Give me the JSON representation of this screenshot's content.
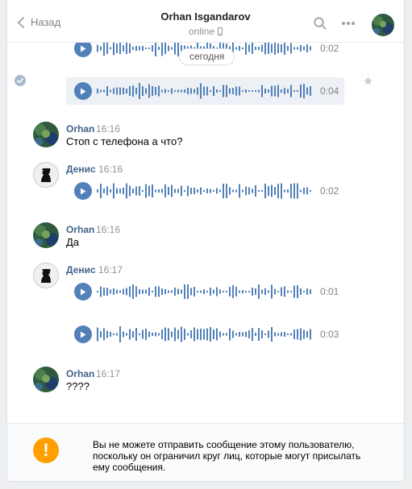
{
  "header": {
    "back_label": "Назад",
    "title": "Orhan Isgandarov",
    "status": "online"
  },
  "date_divider": "сегодня",
  "messages": [
    {
      "sender": "Orhan",
      "time": "16:16",
      "text": "Стоп с телефона а что?"
    },
    {
      "sender": "Денис",
      "time": "16:16",
      "voice_duration": "0:02"
    },
    {
      "sender": "Orhan",
      "time": "16:16",
      "text": "Да"
    },
    {
      "sender": "Денис",
      "time": "16:17",
      "voice_durations": [
        "0:01",
        "0:03"
      ]
    },
    {
      "sender": "Orhan",
      "time": "16:17",
      "text": "????"
    }
  ],
  "top_voices": [
    {
      "duration": "0:02"
    },
    {
      "duration": "0:04"
    }
  ],
  "notice": "Вы не можете отправить сообщение этому пользователю, поскольку он ограничил круг лиц, которые могут присылать ему сообщения.",
  "colors": {
    "accent": "#5181b8",
    "name": "#42648b",
    "warning": "#ffa000",
    "background": "#edeef0"
  },
  "icons": [
    "chevron-left-icon",
    "phone-icon",
    "search-icon",
    "more-icon",
    "check-circle-icon",
    "star-icon",
    "play-icon",
    "warning-icon"
  ]
}
